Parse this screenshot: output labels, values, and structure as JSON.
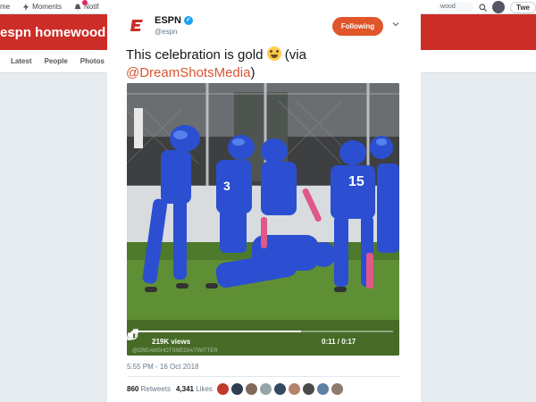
{
  "topnav": {
    "items": [
      {
        "label": "me",
        "icon": "home-icon"
      },
      {
        "label": "Moments",
        "icon": "lightning-icon"
      },
      {
        "label": "Notif",
        "icon": "bell-icon"
      }
    ],
    "search_fragment": "wood",
    "tweet_label": "Twe"
  },
  "profile": {
    "banner_title": "espn homewood",
    "tabs": [
      "Latest",
      "People",
      "Photos"
    ]
  },
  "tweet": {
    "author_name": "ESPN",
    "handle": "@espn",
    "follow_label": "Following",
    "text": "This celebration is gold",
    "via_prefix": "(via",
    "mention": "@DreamShotsMedia",
    "via_suffix": ")",
    "video": {
      "views": "219K views",
      "time": "0:11 / 0:17",
      "watermark": "@DREAMSHOTSMEDIA/TWITTER",
      "progress": 0.647
    },
    "timestamp": "5:55 PM - 16 Oct 2018",
    "retweets": "860",
    "retweets_label": "Retweets",
    "likes": "4,341",
    "likes_label": "Likes"
  },
  "colors": {
    "brand": "#cc2d27",
    "follow": "#e0562a",
    "verified": "#1da1f2",
    "mention": "#d9532f"
  }
}
